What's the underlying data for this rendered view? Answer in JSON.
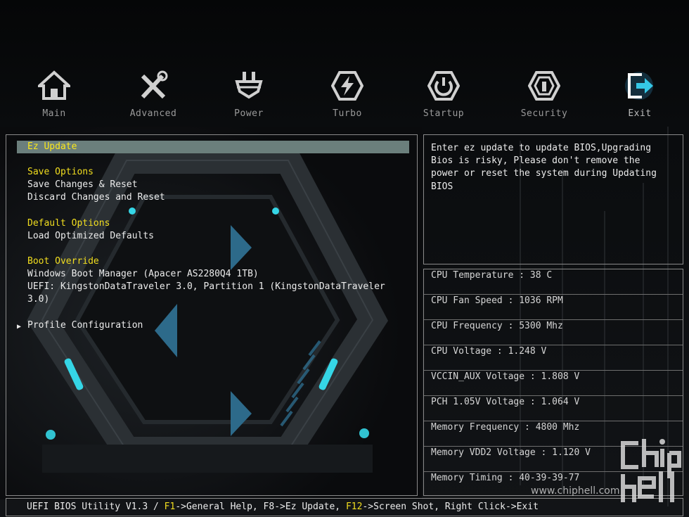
{
  "nav": {
    "items": [
      {
        "id": "main",
        "label": "Main",
        "icon": "home-icon"
      },
      {
        "id": "advanced",
        "label": "Advanced",
        "icon": "tools-icon"
      },
      {
        "id": "power",
        "label": "Power",
        "icon": "power-plug-icon"
      },
      {
        "id": "turbo",
        "label": "Turbo",
        "icon": "lightning-icon"
      },
      {
        "id": "startup",
        "label": "Startup",
        "icon": "power-button-icon"
      },
      {
        "id": "security",
        "label": "Security",
        "icon": "shield-icon"
      },
      {
        "id": "exit",
        "label": "Exit",
        "icon": "exit-icon"
      }
    ],
    "active": "exit"
  },
  "menu": {
    "ez_update": "Ez Update",
    "save_options": "Save Options",
    "save_changes_reset": "Save Changes & Reset",
    "discard_changes_reset": "Discard Changes and Reset",
    "default_options": "Default Options",
    "load_optimized_defaults": "Load Optimized Defaults",
    "boot_override": "Boot Override",
    "windows_boot_manager": "Windows Boot Manager (Apacer AS2280Q4 1TB)",
    "uefi_kingston_line1": "UEFI: KingstonDataTraveler 3.0, Partition 1 (KingstonDataTraveler",
    "uefi_kingston_line2": "3.0)",
    "profile_configuration": "Profile Configuration"
  },
  "help": {
    "text": "Enter ez update to update BIOS,Upgrading\nBios is risky, Please don't remove the\npower or reset the system during Updating\nBIOS"
  },
  "status": [
    "CPU Temperature : 38 C",
    "CPU Fan Speed : 1036 RPM",
    "CPU Frequency : 5300 Mhz",
    "CPU Voltage : 1.248 V",
    "VCCIN_AUX Voltage : 1.808 V",
    "PCH 1.05V Voltage : 1.064 V",
    "Memory Frequency : 4800 Mhz",
    "Memory VDD2 Voltage : 1.120 V",
    "Memory Timing : 40-39-39-77"
  ],
  "footer": {
    "prefix": "UEFI BIOS Utility V1.3 / ",
    "f1": "F1",
    "f1_text": "->General Help, F8->Ez Update, ",
    "f12": "F12",
    "f12_text": "->Screen Shot, Right Click->Exit"
  },
  "watermark": {
    "site": "www.chiphell.com",
    "logo_text": "chip hell"
  },
  "colors": {
    "accent_yellow": "#f2de1f",
    "selection_bg": "#6b7f7c",
    "border": "#8a8a8a",
    "cyan_glow": "#35d6e6"
  }
}
